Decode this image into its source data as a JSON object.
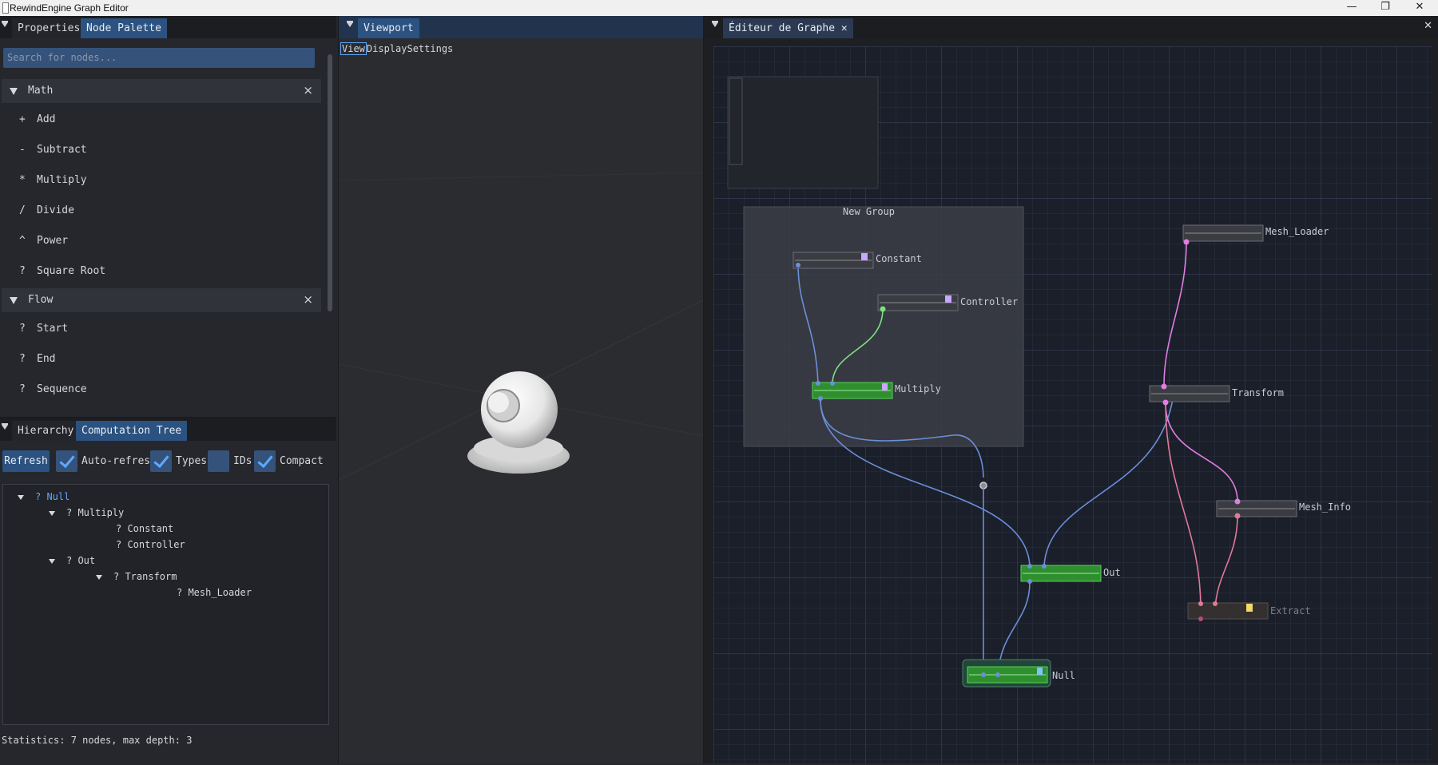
{
  "window": {
    "title": "RewindEngine Graph Editor",
    "minimize": "—",
    "maximize": "❐",
    "close": "✕"
  },
  "left_top": {
    "tabs": [
      {
        "label": "Properties"
      },
      {
        "label": "Node Palette"
      }
    ],
    "search_placeholder": "Search for nodes...",
    "categories": [
      {
        "name": "Math",
        "close": "×",
        "items": [
          {
            "symbol": "+",
            "label": "Add"
          },
          {
            "symbol": "-",
            "label": "Subtract"
          },
          {
            "symbol": "*",
            "label": "Multiply"
          },
          {
            "symbol": "/",
            "label": "Divide"
          },
          {
            "symbol": "^",
            "label": "Power"
          },
          {
            "symbol": "?",
            "label": "Square Root"
          }
        ]
      },
      {
        "name": "Flow",
        "close": "×",
        "items": [
          {
            "symbol": "?",
            "label": "Start"
          },
          {
            "symbol": "?",
            "label": "End"
          },
          {
            "symbol": "?",
            "label": "Sequence"
          }
        ]
      }
    ]
  },
  "left_bottom": {
    "tabs": [
      {
        "label": "Hierarchy"
      },
      {
        "label": "Computation Tree"
      }
    ],
    "refresh": "Refresh",
    "options": [
      {
        "label": "Auto-refresh",
        "checked": true
      },
      {
        "label": "Types",
        "checked": true
      },
      {
        "label": "IDs",
        "checked": false
      },
      {
        "label": "Compact",
        "checked": true
      }
    ],
    "tree": [
      {
        "label": "? Null",
        "expanded": true,
        "accent": "#5ea8ff"
      },
      {
        "label": "? Multiply",
        "expanded": true
      },
      {
        "label": "? Constant"
      },
      {
        "label": "? Controller"
      },
      {
        "label": "? Out",
        "expanded": true
      },
      {
        "label": "? Transform",
        "expanded": true
      },
      {
        "label": "? Mesh_Loader"
      }
    ],
    "statistics": "Statistics: 7 nodes, max depth: 3"
  },
  "viewport": {
    "tab": "Viewport",
    "menu_view": "View",
    "menu_display": "DisplaySettings"
  },
  "graph_editor": {
    "tab": "Éditeur de Graphe",
    "tab_close": "✕",
    "panel_close": "✕",
    "group_title": "New Group",
    "nodes": [
      {
        "name": "Constant",
        "color": "#3a3c42",
        "swatch": "#c9a6ff"
      },
      {
        "name": "Controller",
        "color": "#3a3c42",
        "swatch": "#c9a6ff"
      },
      {
        "name": "Multiply",
        "color": "#2f8f2f",
        "swatch": "#c9a6ff"
      },
      {
        "name": "Mesh_Loader",
        "color": "#3a3c42"
      },
      {
        "name": "Transform",
        "color": "#3a3c42"
      },
      {
        "name": "Mesh_Info",
        "color": "#3a3c42"
      },
      {
        "name": "Out",
        "color": "#2f8f2f"
      },
      {
        "name": "Extract",
        "color": "#34302f",
        "swatch": "#f2d96b"
      },
      {
        "name": "Null",
        "color": "#2f8f2f",
        "swatch": "#7fc4ff"
      }
    ],
    "colors": {
      "link_blue": "#6b8fd9",
      "link_green": "#7fe07f",
      "link_magenta": "#e27ee0",
      "link_pink": "#e07a9a"
    }
  }
}
